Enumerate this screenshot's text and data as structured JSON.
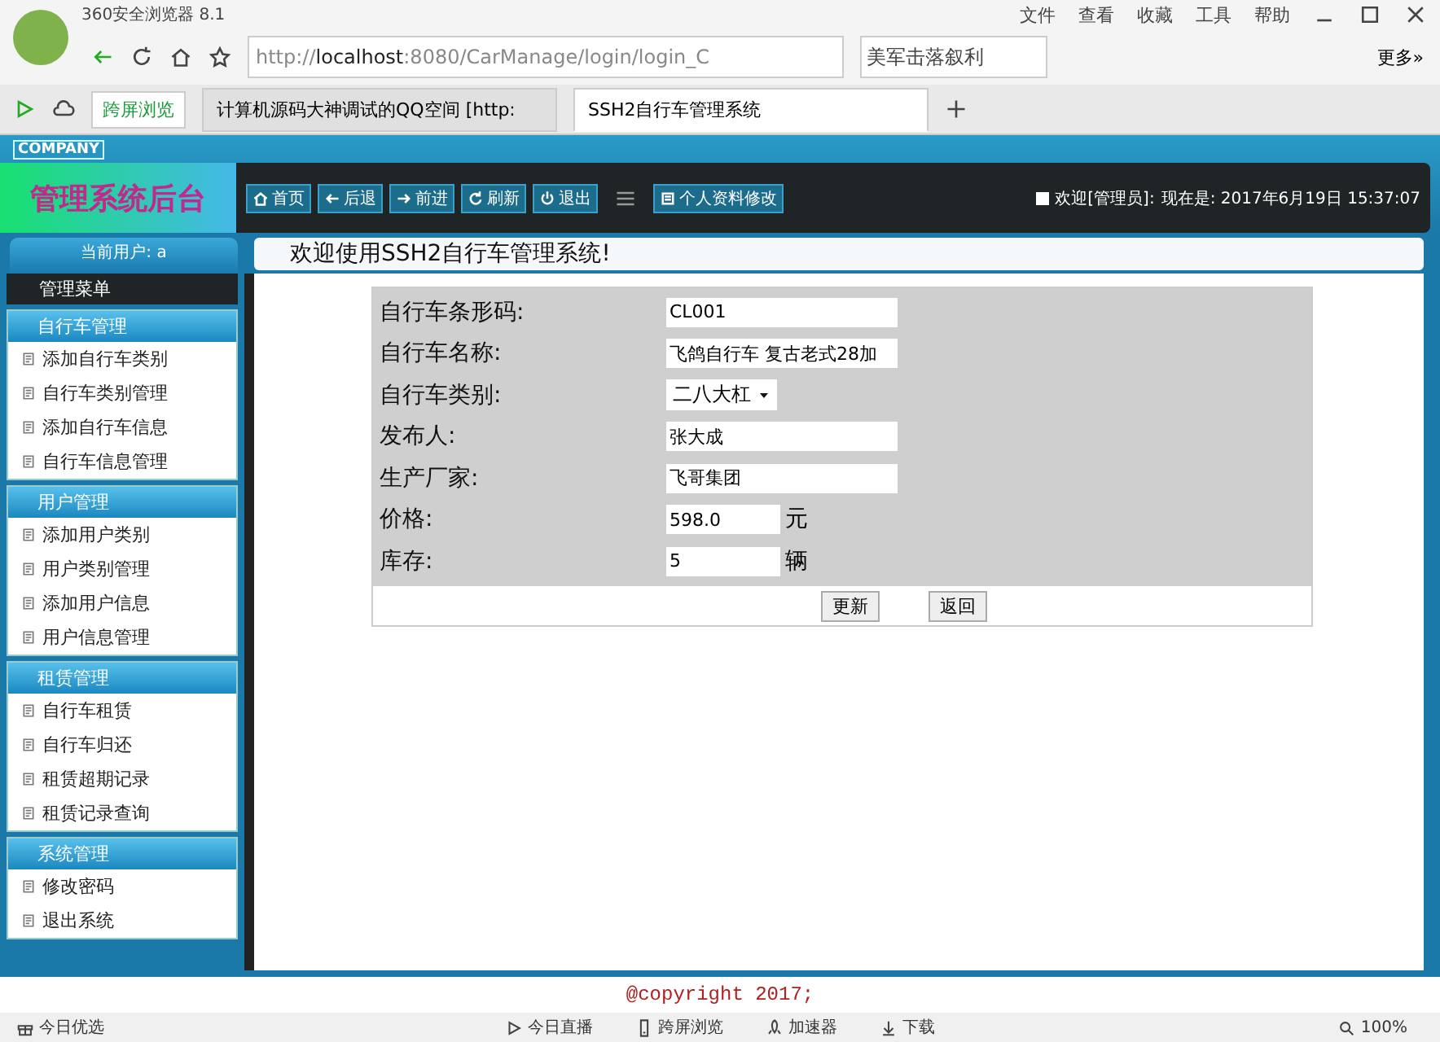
{
  "browser": {
    "title": "360安全浏览器 8.1",
    "menu": [
      "文件",
      "查看",
      "收藏",
      "工具",
      "帮助"
    ],
    "url": "http://**localhost**:8080/CarManage/login/login_C",
    "search": "美军击落叙利",
    "more": "更多»",
    "cross_screen": "跨屏浏览",
    "tabs": [
      {
        "label": "计算机源码大神调试的QQ空间 [http:",
        "selected": false
      },
      {
        "label": "SSH2自行车管理系统",
        "selected": true
      }
    ]
  },
  "header": {
    "company": "COMPANY",
    "title": "管理系统后台",
    "nav": [
      {
        "label": "首页",
        "kind": "home"
      },
      {
        "label": "后退",
        "kind": "back"
      },
      {
        "label": "前进",
        "kind": "forward"
      },
      {
        "label": "刷新",
        "kind": "refresh"
      },
      {
        "label": "退出",
        "kind": "exit"
      },
      {
        "label": "个人资料修改",
        "kind": "profile"
      }
    ],
    "welcome": "欢迎[管理员]:",
    "now": "现在是: 2017年6月19日 15:37:07"
  },
  "current_user": "当前用户: a",
  "page_title": "欢迎使用SSH2自行车管理系统!",
  "sidebar": {
    "title": "管理菜单",
    "groups": [
      {
        "title": "自行车管理",
        "items": [
          "添加自行车类别",
          "自行车类别管理",
          "添加自行车信息",
          "自行车信息管理"
        ]
      },
      {
        "title": "用户管理",
        "items": [
          "添加用户类别",
          "用户类别管理",
          "添加用户信息",
          "用户信息管理"
        ]
      },
      {
        "title": "租赁管理",
        "items": [
          "自行车租赁",
          "自行车归还",
          "租赁超期记录",
          "租赁记录查询"
        ]
      },
      {
        "title": "系统管理",
        "items": [
          "修改密码",
          "退出系统"
        ]
      }
    ]
  },
  "form": {
    "rows": [
      {
        "label": "自行车条形码:",
        "kind": "text",
        "value": "CL001"
      },
      {
        "label": "自行车名称:",
        "kind": "text",
        "value": "飞鸽自行车 复古老式28加"
      },
      {
        "label": "自行车类别:",
        "kind": "select",
        "value": "二八大杠"
      },
      {
        "label": "发布人:",
        "kind": "text",
        "value": "张大成"
      },
      {
        "label": "生产厂家:",
        "kind": "text",
        "value": "飞哥集团"
      },
      {
        "label": "价格:",
        "kind": "short",
        "value": "598.0",
        "unit": "元"
      },
      {
        "label": "库存:",
        "kind": "short",
        "value": "5",
        "unit": "辆"
      }
    ],
    "buttons": [
      "更新",
      "返回"
    ]
  },
  "footer": "@copyright 2017;",
  "status_bar": [
    {
      "label": "今日优选",
      "kind": "gift"
    },
    {
      "label": "今日直播",
      "kind": "play"
    },
    {
      "label": "跨屏浏览",
      "kind": "phone"
    },
    {
      "label": "加速器",
      "kind": "rocket"
    },
    {
      "label": "下载",
      "kind": "download"
    },
    {
      "label": "100%",
      "kind": "zoom"
    }
  ]
}
